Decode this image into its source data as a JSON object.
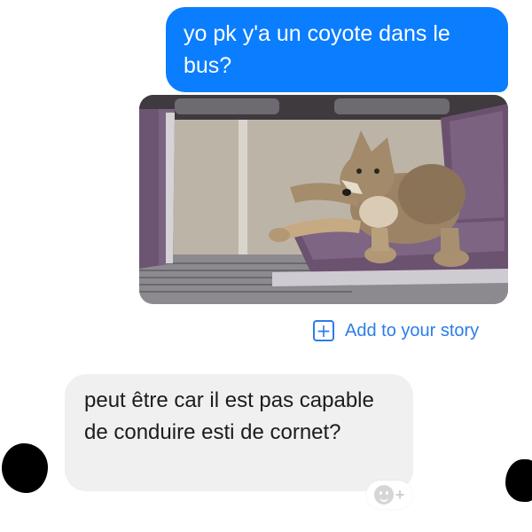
{
  "conversation": {
    "outgoing_message": "yo pk y'a un coyote dans le bus?",
    "attachment": {
      "type": "photo",
      "subject": "coyote lying on bus seats"
    },
    "story_action": {
      "icon": "plus-square-icon",
      "label": "Add to your story"
    },
    "incoming_message": "peut être car il est pas capable de conduire esti de cornet?",
    "reaction_button": {
      "icon": "smiley-plus-icon",
      "glyph": "+"
    }
  },
  "colors": {
    "outgoing_bubble": "#0b7dff",
    "incoming_bubble": "#f0f0f0",
    "link_blue": "#2b7de9",
    "background": "#ffffff"
  }
}
